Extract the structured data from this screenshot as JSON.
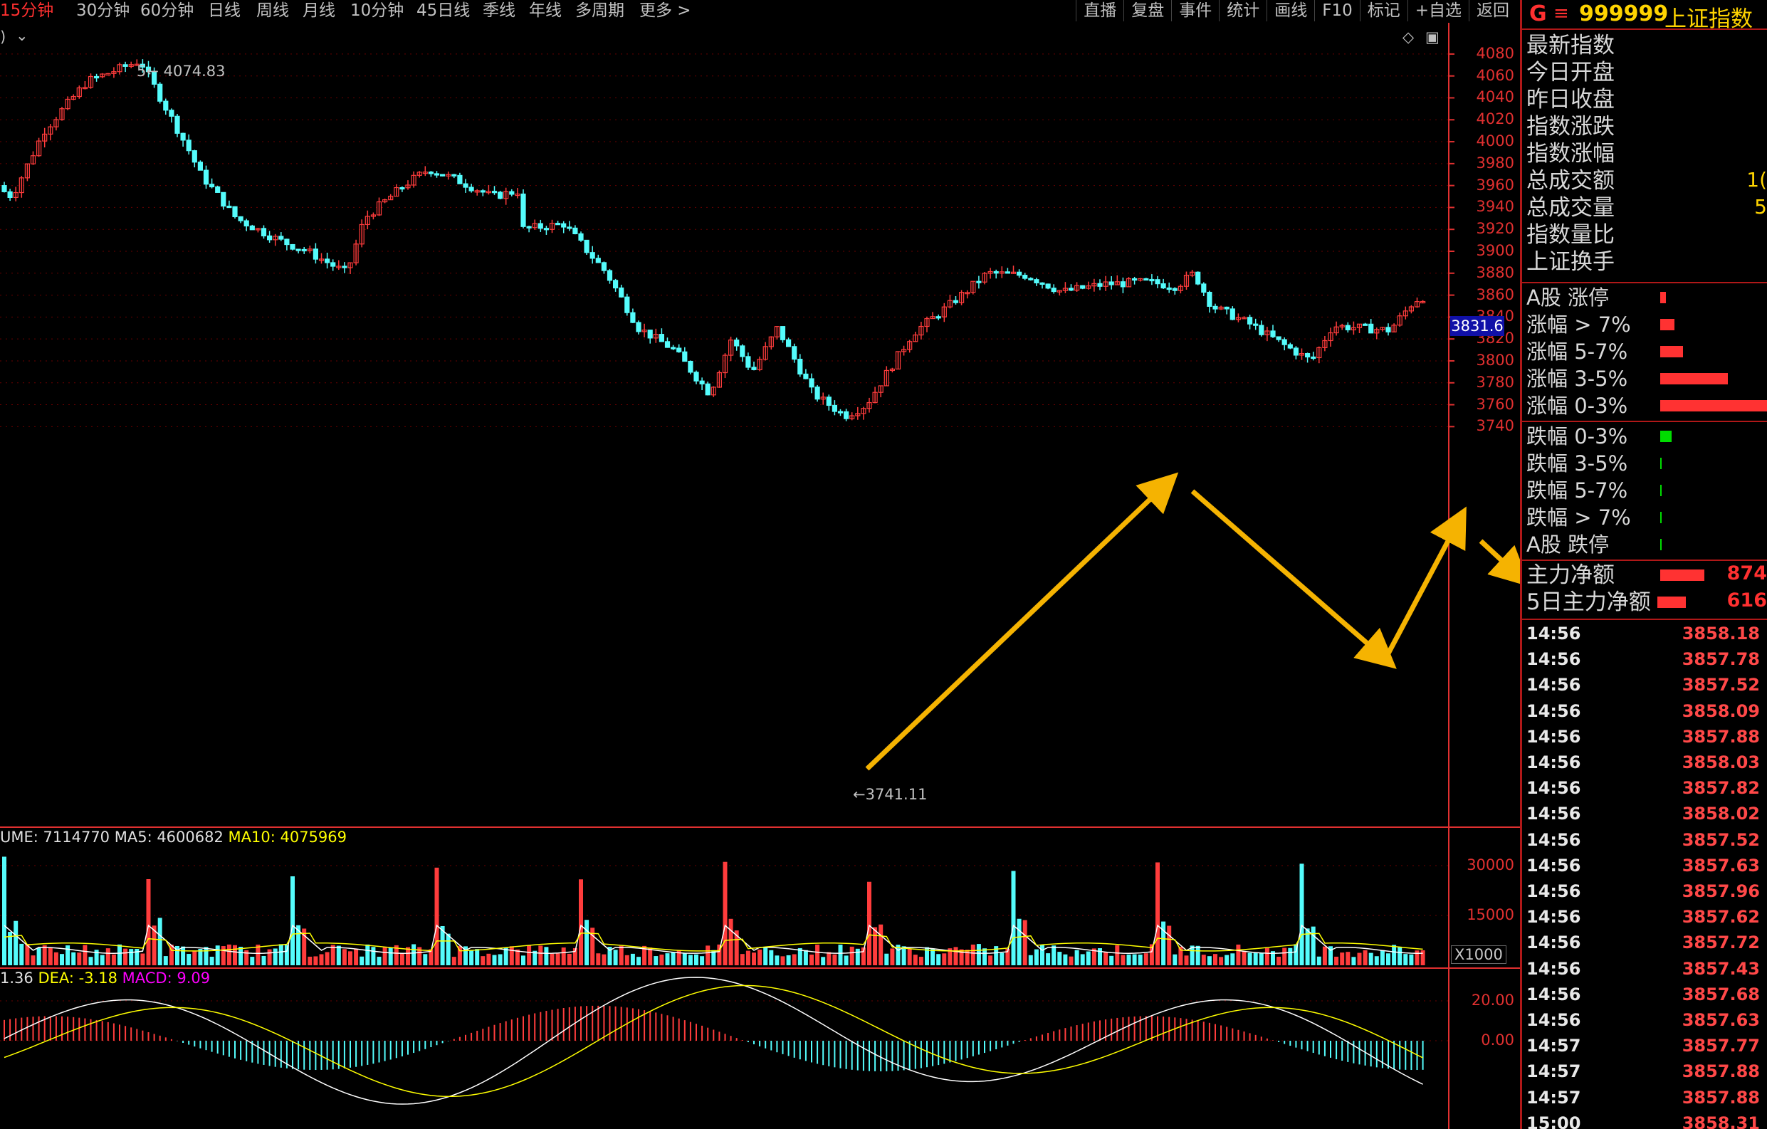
{
  "topbar": {
    "periods": [
      "15分钟",
      "30分钟",
      "60分钟",
      "日线",
      "周线",
      "月线",
      "10分钟",
      "45日线",
      "季线",
      "年线",
      "多周期",
      "更多 >"
    ],
    "active": "15分钟",
    "tools": [
      "直播",
      "复盘",
      "事件",
      "统计",
      "画线",
      "F10",
      "标记",
      "+自选",
      "返回"
    ]
  },
  "main": {
    "y_axis": [
      "4080",
      "4060",
      "4040",
      "4020",
      "4000",
      "3980",
      "3960",
      "3940",
      "3920",
      "3900",
      "3880",
      "3860",
      "3840",
      "3820",
      "3800",
      "3780",
      "3760",
      "3740"
    ],
    "current_price_tag": "3831.6",
    "high_label": "4074.83",
    "low_label": "3741.11",
    "high_marker": "5",
    "left_marker": ")"
  },
  "volume": {
    "label_vol": "UME: 7114770",
    "label_ma5": "MA5: 4600682",
    "label_ma10": "MA10: 4075969",
    "y_axis": [
      "30000",
      "15000"
    ],
    "unit": "X1000"
  },
  "macd": {
    "label_dif": "1.36",
    "label_dea": "DEA: -3.18",
    "label_macd": "MACD: 9.09",
    "y_axis": [
      "20.00",
      "0.00"
    ]
  },
  "colors": {
    "up": "#ff3c3c",
    "down": "#54fcfc",
    "axis": "#e03030",
    "grid": "#6a0000",
    "arrow": "#f5b301",
    "ma5": "#ffffff",
    "ma10": "#ffff00",
    "macd_label": "#ff00ff"
  },
  "panel": {
    "code": "999999",
    "name": "上证指数",
    "g_icon": "G",
    "fields": [
      "最新指数",
      "今日开盘",
      "昨日收盘",
      "指数涨跌",
      "指数涨幅",
      "总成交额",
      "总成交量",
      "指数量比",
      "上证换手"
    ],
    "field_values_partial": [
      "",
      "",
      "",
      "",
      "",
      "1(",
      "5",
      "",
      ""
    ],
    "dist_up": [
      {
        "label": "A股 涨停",
        "w": 8
      },
      {
        "label": "涨幅 > 7%",
        "w": 20
      },
      {
        "label": "涨幅 5-7%",
        "w": 32
      },
      {
        "label": "涨幅 3-5%",
        "w": 95
      },
      {
        "label": "涨幅 0-3%",
        "w": 160
      }
    ],
    "dist_down": [
      {
        "label": "跌幅 0-3%",
        "w": 16
      },
      {
        "label": "跌幅 3-5%",
        "w": 2
      },
      {
        "label": "跌幅 5-7%",
        "w": 2
      },
      {
        "label": "跌幅 > 7%",
        "w": 2
      },
      {
        "label": "A股 跌停",
        "w": 2
      }
    ],
    "flow": [
      {
        "label": "主力净额",
        "value": "874"
      },
      {
        "label": "5日主力净额",
        "value": "616"
      }
    ],
    "ticks": [
      [
        "14:56",
        "3858.18"
      ],
      [
        "14:56",
        "3857.78"
      ],
      [
        "14:56",
        "3857.52"
      ],
      [
        "14:56",
        "3858.09"
      ],
      [
        "14:56",
        "3857.88"
      ],
      [
        "14:56",
        "3858.03"
      ],
      [
        "14:56",
        "3857.82"
      ],
      [
        "14:56",
        "3858.02"
      ],
      [
        "14:56",
        "3857.52"
      ],
      [
        "14:56",
        "3857.63"
      ],
      [
        "14:56",
        "3857.96"
      ],
      [
        "14:56",
        "3857.62"
      ],
      [
        "14:56",
        "3857.72"
      ],
      [
        "14:56",
        "3857.43"
      ],
      [
        "14:56",
        "3857.68"
      ],
      [
        "14:56",
        "3857.63"
      ],
      [
        "14:57",
        "3857.77"
      ],
      [
        "14:57",
        "3857.88"
      ],
      [
        "14:57",
        "3857.88"
      ],
      [
        "15:00",
        "3858.31"
      ]
    ]
  }
}
